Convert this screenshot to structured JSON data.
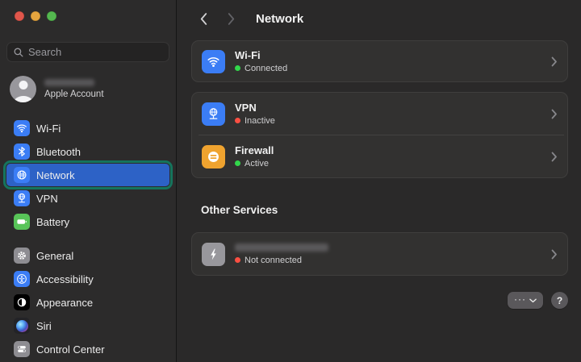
{
  "window": {
    "traffic_lights": {
      "close": "#e0564b",
      "minimize": "#e5a43e",
      "zoom": "#54b84f"
    }
  },
  "sidebar": {
    "search": {
      "placeholder": "Search"
    },
    "account": {
      "label": "Apple Account",
      "name_redacted": true
    },
    "nav_primary": [
      {
        "label": "Wi-Fi",
        "icon": "wifi-icon",
        "icon_bg": "#3b7df5",
        "selected": false
      },
      {
        "label": "Bluetooth",
        "icon": "bluetooth-icon",
        "icon_bg": "#3b7df5",
        "selected": false
      },
      {
        "label": "Network",
        "icon": "globe-icon",
        "icon_bg": "#3b7df5",
        "selected": true,
        "annotation_color": "#15745d"
      },
      {
        "label": "VPN",
        "icon": "vpn-globe-icon",
        "icon_bg": "#3b7df5",
        "selected": false
      },
      {
        "label": "Battery",
        "icon": "battery-icon",
        "icon_bg": "#58c458",
        "selected": false
      }
    ],
    "nav_secondary": [
      {
        "label": "General",
        "icon": "gear-icon",
        "icon_bg": "#8e8d92"
      },
      {
        "label": "Accessibility",
        "icon": "accessibility-icon",
        "icon_bg": "#3b7df5"
      },
      {
        "label": "Appearance",
        "icon": "appearance-icon",
        "icon_bg": "#000000"
      },
      {
        "label": "Siri",
        "icon": "siri-icon",
        "icon_bg": "#232327"
      },
      {
        "label": "Control Center",
        "icon": "control-center-icon",
        "icon_bg": "#8e8d92"
      }
    ]
  },
  "header": {
    "title": "Network",
    "back_enabled": true,
    "forward_enabled": false
  },
  "content": {
    "wifi_card": {
      "title": "Wi-Fi",
      "status": "Connected",
      "status_color": "#32d74b",
      "icon": "wifi-icon",
      "icon_bg": "#3b7df5"
    },
    "services_card": [
      {
        "title": "VPN",
        "status": "Inactive",
        "status_color": "#fb4f42",
        "icon": "vpn-globe-icon",
        "icon_bg": "#3b7df5"
      },
      {
        "title": "Firewall",
        "status": "Active",
        "status_color": "#32d74b",
        "icon": "firewall-icon",
        "icon_bg": "#efa32f"
      }
    ],
    "other_services": {
      "heading": "Other Services",
      "items": [
        {
          "title_redacted": true,
          "status": "Not connected",
          "status_color": "#fb4f42",
          "icon": "thunderbolt-icon",
          "icon_bg": "#98979c"
        }
      ]
    },
    "footer": {
      "more_label": "···",
      "help_label": "?"
    }
  }
}
